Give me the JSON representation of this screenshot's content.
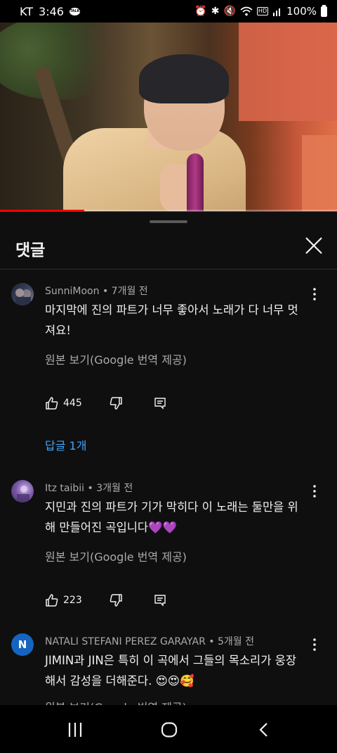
{
  "status_bar": {
    "carrier": "KT",
    "time": "3:46",
    "talk_badge": "TALK",
    "battery": "100%"
  },
  "video": {
    "progress": 0.25
  },
  "comments_panel": {
    "title": "댓글",
    "comments": [
      {
        "author": "SunniMoon",
        "age": "7개월 전",
        "text": "마지막에 진의 파트가 너무 좋아서 노래가 다 너무 멋져요!",
        "translate_label": "원본 보기(Google 번역 제공)",
        "likes": "445",
        "replies_label": "답글 1개"
      },
      {
        "author": "Itz taibii",
        "age": "3개월 전",
        "text": "지민과 진의 파트가 기가 막히다 이 노래는 둘만을 위해 만들어진 곡입니다💜💜",
        "translate_label": "원본 보기(Google 번역 제공)",
        "likes": "223"
      },
      {
        "author": "NATALI STEFANI PEREZ GARAYAR",
        "age": "5개월 전",
        "avatar_letter": "N",
        "text": "JIMIN과 JIN은 특히 이 곡에서 그들의 목소리가 웅장해서 감성을 더해준다. 😍😍🥰",
        "translate_label": "원본 보기(Google 번역 제공)"
      }
    ]
  },
  "colors": {
    "background": "#0f0f0f",
    "link_blue": "#3ea6ff",
    "progress_red": "#ff0000",
    "avatar_blue": "#1565c0"
  }
}
